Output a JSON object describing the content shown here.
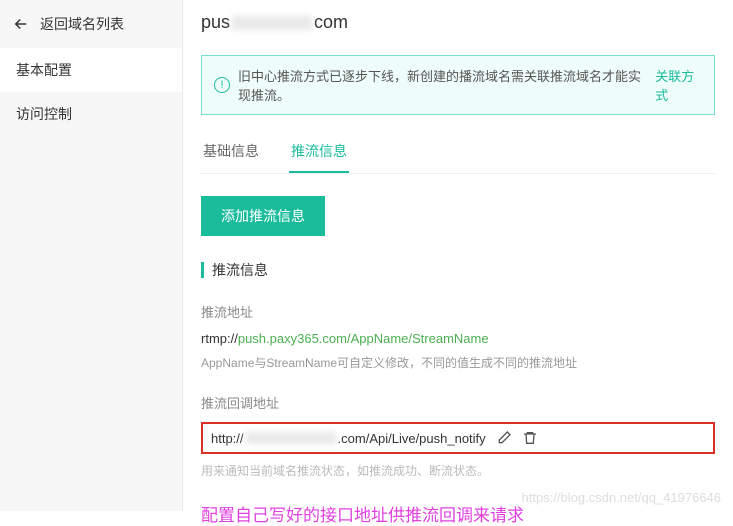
{
  "sidebar": {
    "back_label": "返回域名列表",
    "items": [
      {
        "label": "基本配置",
        "active": true
      },
      {
        "label": "访问控制",
        "active": false
      }
    ]
  },
  "header": {
    "domain_prefix": "pus",
    "domain_suffix": "com"
  },
  "notice": {
    "text": "旧中心推流方式已逐步下线，新创建的播流域名需关联推流域名才能实现推流。",
    "link_label": "关联方式"
  },
  "tabs": [
    {
      "label": "基础信息",
      "active": false
    },
    {
      "label": "推流信息",
      "active": true
    }
  ],
  "add_button_label": "添加推流信息",
  "section_title": "推流信息",
  "push_address": {
    "label": "推流地址",
    "proto": "rtmp://",
    "url": "push.paxy365.com/AppName/StreamName",
    "help": "AppName与StreamName可自定义修改，不同的值生成不同的推流地址"
  },
  "callback": {
    "label": "推流回调地址",
    "url_prefix": "http://",
    "url_suffix": ".com/Api/Live/push_notify",
    "help": "用来通知当前域名推流状态，如推流成功、断流状态。"
  },
  "annotation": "配置自己写好的接口地址供推流回调来请求",
  "watermark": "https://blog.csdn.net/qq_41976646"
}
